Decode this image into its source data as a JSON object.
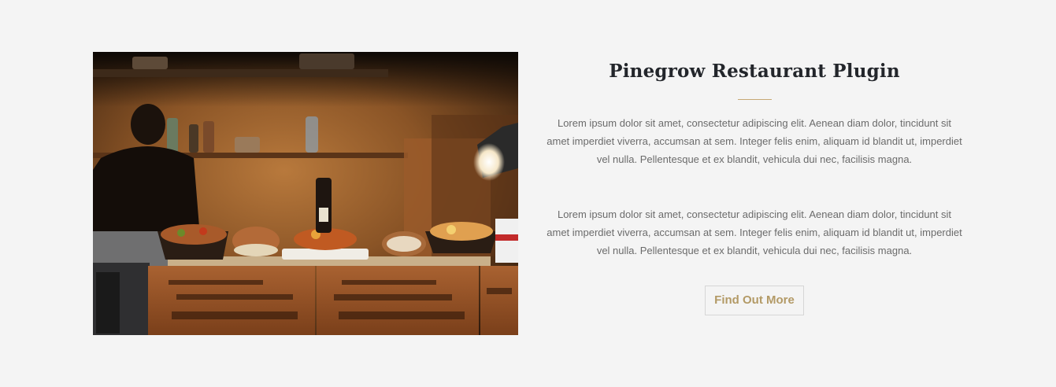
{
  "feature": {
    "title": "Pinegrow Restaurant Plugin",
    "paragraph_1": "Lorem ipsum dolor sit amet, consectetur adipiscing elit. Aenean diam dolor, tincidunt sit amet imperdiet viverra, accumsan at sem. Integer felis enim, aliquam id blandit ut, imperdiet vel nulla. Pellentesque et ex blandit, vehicula dui nec, facilisis magna.",
    "paragraph_2": "Lorem ipsum dolor sit amet, consectetur adipiscing elit. Aenean diam dolor, tincidunt sit amet imperdiet viverra, accumsan at sem. Integer felis enim, aliquam id blandit ut, imperdiet vel nulla. Pellentesque et ex blandit, vehicula dui nec, facilisis magna.",
    "button_label": "Find Out More"
  },
  "colors": {
    "background": "#f4f4f4",
    "title": "#23262b",
    "accent": "#c7a874",
    "button_text": "#b39a66",
    "body_text": "#6b6b6b"
  }
}
